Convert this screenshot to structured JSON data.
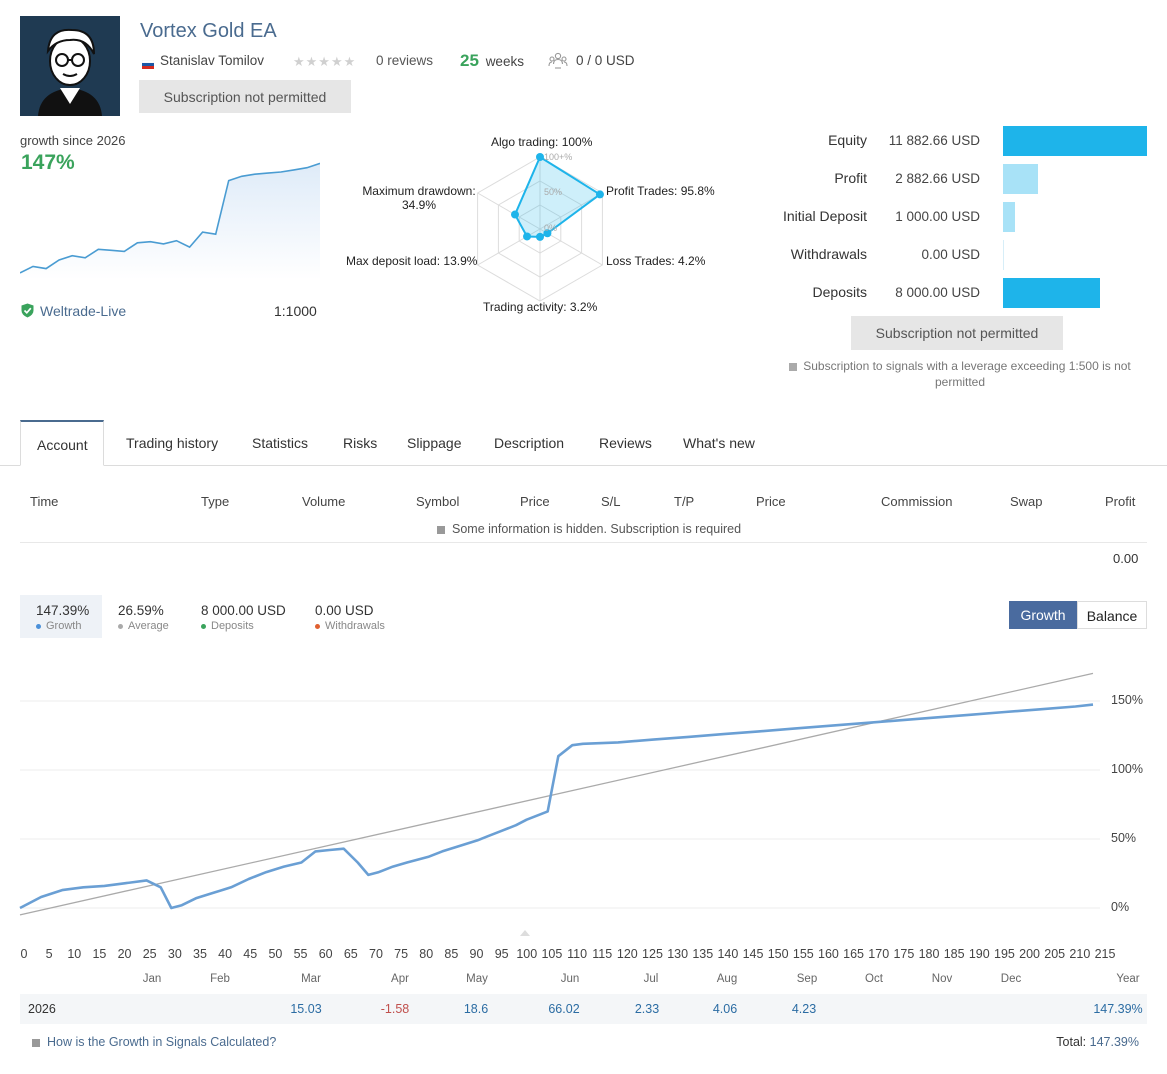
{
  "header": {
    "title": "Vortex Gold EA",
    "author": "Stanislav Tomilov",
    "reviews": "0 reviews",
    "weeks_num": "25",
    "weeks_label": "weeks",
    "subscribers": "0 / 0 USD",
    "subscribe_button": "Subscription not permitted"
  },
  "growth_summary": {
    "label": "growth since 2026",
    "value": "147%",
    "broker": "Weltrade-Live",
    "leverage": "1:1000",
    "mini_chart_values": [
      2,
      8,
      6,
      14,
      18,
      16,
      24,
      23,
      22,
      30,
      31,
      29,
      32,
      26,
      40,
      38,
      88,
      92,
      94,
      95,
      96,
      98,
      100,
      104
    ]
  },
  "radar": {
    "algo": "Algo trading: 100%",
    "profit_trades": "Profit Trades: 95.8%",
    "loss_trades": "Loss Trades: 4.2%",
    "trading_activity": "Trading activity: 3.2%",
    "max_deposit_load": "Max deposit load: 13.9%",
    "max_drawdown_1": "Maximum drawdown:",
    "max_drawdown_2": "34.9%",
    "ring_100": "100+%",
    "ring_50": "50%",
    "ring_0": "0%",
    "values": [
      100,
      95.8,
      4.2,
      3.2,
      13.9,
      34.9
    ]
  },
  "stats": [
    {
      "label": "Equity",
      "value": "11 882.66 USD",
      "bar": 1.0,
      "color": "#1eb4ea"
    },
    {
      "label": "Profit",
      "value": "2 882.66 USD",
      "bar": 0.243,
      "color": "#a8e2f7"
    },
    {
      "label": "Initial Deposit",
      "value": "1 000.00 USD",
      "bar": 0.084,
      "color": "#a8e2f7"
    },
    {
      "label": "Withdrawals",
      "value": "0.00 USD",
      "bar": 0.0,
      "color": "#a8e2f7"
    },
    {
      "label": "Deposits",
      "value": "8 000.00 USD",
      "bar": 0.673,
      "color": "#1eb4ea"
    }
  ],
  "right_panel": {
    "subscribe_button": "Subscription not permitted",
    "leverage_note_1": "Subscription to signals with a leverage exceeding 1:500 is not",
    "leverage_note_2": "permitted"
  },
  "tabs": [
    "Account",
    "Trading history",
    "Statistics",
    "Risks",
    "Slippage",
    "Description",
    "Reviews",
    "What's new"
  ],
  "table": {
    "headers": [
      "Time",
      "Type",
      "Volume",
      "Symbol",
      "Price",
      "S/L",
      "T/P",
      "Price",
      "Commission",
      "Swap",
      "Profit"
    ],
    "hidden_note": "Some information is hidden. Subscription is required",
    "total_profit": "0.00"
  },
  "legend": [
    {
      "value": "147.39%",
      "label": "Growth",
      "color": "#4a90d9"
    },
    {
      "value": "26.59%",
      "label": "Average",
      "color": "#aaaaaa"
    },
    {
      "value": "8 000.00 USD",
      "label": "Deposits",
      "color": "#3aa35c"
    },
    {
      "value": "0.00 USD",
      "label": "Withdrawals",
      "color": "#e06030"
    }
  ],
  "toggle": {
    "growth": "Growth",
    "balance": "Balance"
  },
  "chart_data": {
    "type": "line",
    "y_unit": "%",
    "yticks": [
      "150%",
      "100%",
      "50%",
      "0%"
    ],
    "ylim": [
      -5,
      175
    ],
    "xlim": [
      0,
      215
    ],
    "xticks": [
      "0",
      "5",
      "10",
      "15",
      "20",
      "25",
      "30",
      "35",
      "40",
      "45",
      "50",
      "55",
      "60",
      "65",
      "70",
      "75",
      "80",
      "85",
      "90",
      "95",
      "100",
      "105",
      "110",
      "115",
      "120",
      "125",
      "130",
      "135",
      "140",
      "145",
      "150",
      "155",
      "160",
      "165",
      "170",
      "175",
      "180",
      "185",
      "190",
      "195",
      "200",
      "205",
      "210",
      "215"
    ],
    "series": [
      {
        "color": "#6a9fd4",
        "points": [
          [
            0,
            0
          ],
          [
            6,
            8
          ],
          [
            12,
            13
          ],
          [
            18,
            15
          ],
          [
            24,
            16
          ],
          [
            30,
            18
          ],
          [
            36,
            20
          ],
          [
            40,
            15
          ],
          [
            43,
            0
          ],
          [
            46,
            2
          ],
          [
            50,
            7
          ],
          [
            55,
            11
          ],
          [
            60,
            15
          ],
          [
            65,
            21
          ],
          [
            70,
            26
          ],
          [
            75,
            30
          ],
          [
            80,
            33
          ],
          [
            84,
            41
          ],
          [
            88,
            42
          ],
          [
            92,
            43
          ],
          [
            96,
            33
          ],
          [
            99,
            24
          ],
          [
            102,
            26
          ],
          [
            106,
            30
          ],
          [
            110,
            33
          ],
          [
            116,
            37
          ],
          [
            120,
            41
          ],
          [
            125,
            45
          ],
          [
            130,
            49
          ],
          [
            133,
            52
          ],
          [
            137,
            56
          ],
          [
            141,
            60
          ],
          [
            144,
            64
          ],
          [
            148,
            68
          ],
          [
            150,
            70
          ],
          [
            153,
            110
          ],
          [
            157,
            118
          ],
          [
            160,
            119
          ],
          [
            170,
            120
          ],
          [
            180,
            122
          ],
          [
            190,
            124
          ],
          [
            200,
            126
          ],
          [
            210,
            128
          ],
          [
            220,
            130
          ],
          [
            230,
            132
          ],
          [
            240,
            134
          ],
          [
            250,
            136
          ],
          [
            260,
            138
          ],
          [
            270,
            140
          ],
          [
            280,
            142
          ],
          [
            290,
            144
          ],
          [
            300,
            146
          ],
          [
            305,
            147.39
          ]
        ]
      },
      {
        "color": "#aaaaaa",
        "points": [
          [
            0,
            -5
          ],
          [
            305,
            170
          ]
        ]
      }
    ]
  },
  "months": [
    "Jan",
    "Feb",
    "Mar",
    "Apr",
    "May",
    "Jun",
    "Jul",
    "Aug",
    "Sep",
    "Oct",
    "Nov",
    "Dec",
    "Year"
  ],
  "year_row": {
    "year": "2026",
    "values": [
      "",
      "",
      "15.03",
      "-1.58",
      "18.6",
      "66.02",
      "2.33",
      "4.06",
      "4.23",
      "",
      "",
      "",
      "147.39%"
    ]
  },
  "footer": {
    "how_link": "How is the Growth in Signals Calculated?",
    "total_label": "Total:",
    "total_value": "147.39%"
  }
}
